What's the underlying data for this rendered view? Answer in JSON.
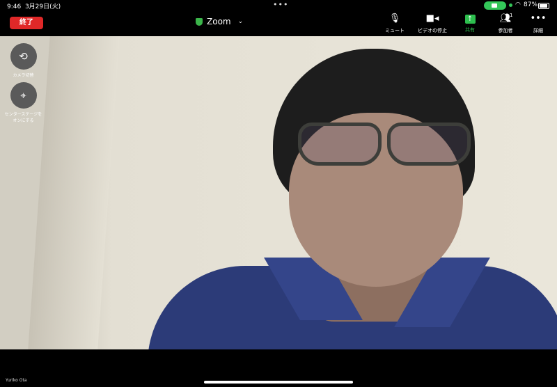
{
  "status_bar": {
    "time": "9:46",
    "date": "3月29日(火)",
    "battery": "87%"
  },
  "toolbar": {
    "end_label": "終了",
    "meeting_title": "Zoom",
    "buttons": [
      {
        "label": "ミュート",
        "icon": "microphone-icon"
      },
      {
        "label": "ビデオの停止",
        "icon": "video-camera-icon"
      },
      {
        "label": "共有",
        "icon": "share-screen-icon"
      },
      {
        "label": "参加者",
        "icon": "participants-icon",
        "badge": "1"
      },
      {
        "label": "詳細",
        "icon": "more-icon"
      }
    ]
  },
  "side_controls": {
    "switch_camera_label": "カメラ切替",
    "center_stage_label": "センターステージをオンにする"
  },
  "participant_name": "Yuriko Ota",
  "colors": {
    "end_button": "#e02828",
    "share_accent": "#2dbf4e",
    "shirt": "#2c3b78"
  }
}
